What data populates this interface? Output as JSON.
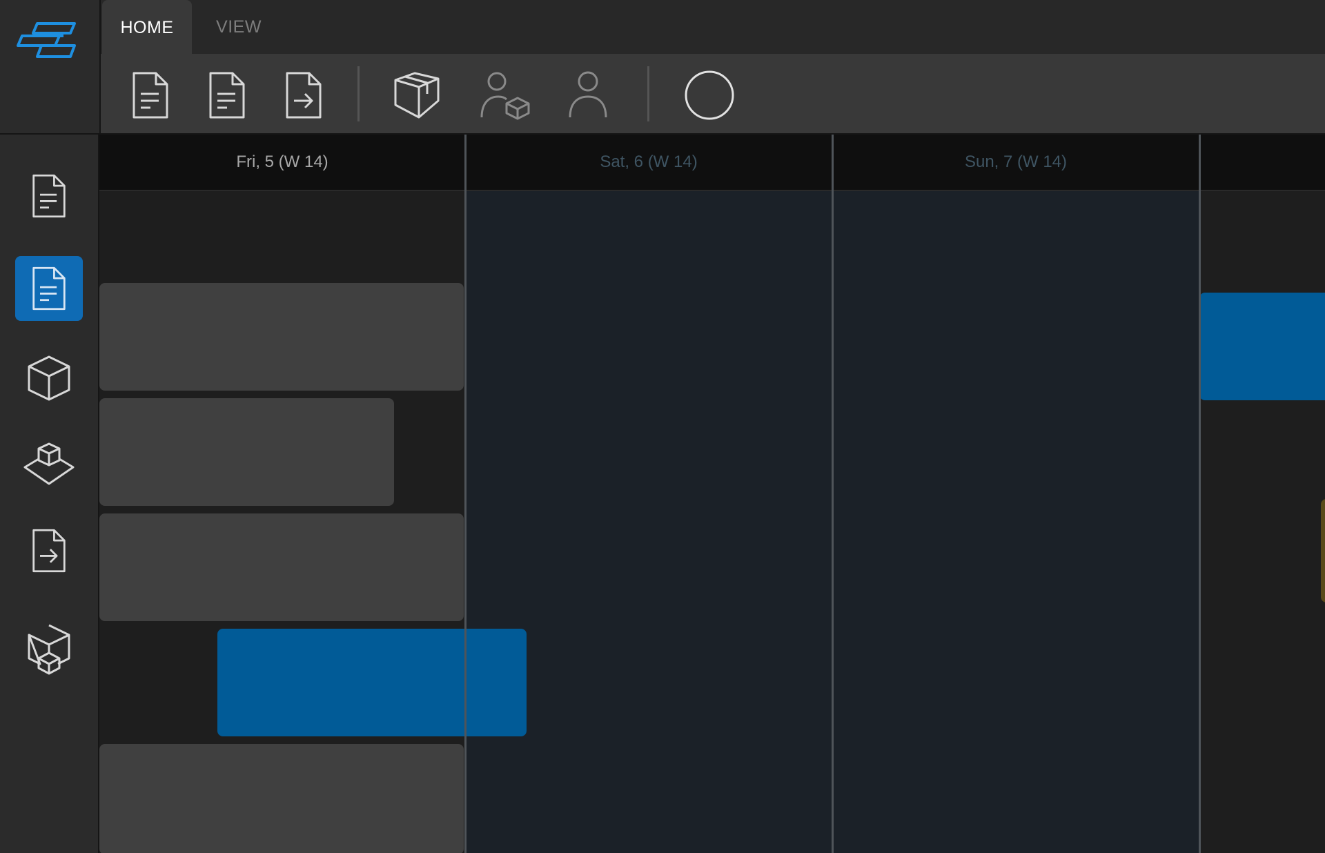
{
  "app": {
    "logo_icon": "stacked-layers-logo-icon",
    "accent": "#0f6bb4"
  },
  "tabs": [
    {
      "label": "HOME",
      "active": true
    },
    {
      "label": "VIEW",
      "active": false
    }
  ],
  "ribbon": {
    "buttons": [
      {
        "icon": "document-icon"
      },
      {
        "icon": "document-icon"
      },
      {
        "icon": "document-export-icon"
      },
      {
        "icon": "package-icon"
      },
      {
        "icon": "user-package-icon"
      },
      {
        "icon": "user-icon"
      },
      {
        "icon": "circle-icon"
      }
    ]
  },
  "sidebar": {
    "items": [
      {
        "icon": "document-icon",
        "active": false
      },
      {
        "icon": "document-icon",
        "active": true
      },
      {
        "icon": "cube-icon",
        "active": false
      },
      {
        "icon": "cube-on-plane-icon",
        "active": false
      },
      {
        "icon": "document-export-icon",
        "active": false
      },
      {
        "icon": "cubes-icon",
        "active": false
      }
    ]
  },
  "timeline": {
    "days": [
      {
        "label": "Fri, 5 (W 14)",
        "weekend": false
      },
      {
        "label": "Sat, 6 (W 14)",
        "weekend": true
      },
      {
        "label": "Sun, 7 (W 14)",
        "weekend": true
      }
    ],
    "colors": {
      "weekday_label": "#a8a8a8",
      "weekend_label": "#3f5563",
      "gray_bar": "#404040",
      "blue_bar": "#015b97"
    }
  }
}
